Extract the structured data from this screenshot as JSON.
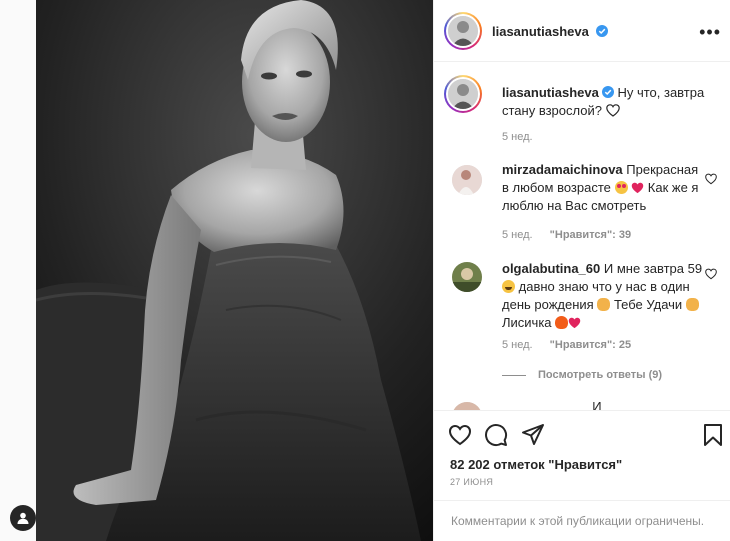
{
  "post": {
    "username": "liasanutiasheva",
    "caption": "Ну что, завтра стану взрослой?",
    "caption_time": "5 нед."
  },
  "comments": [
    {
      "username": "mirzadamaichinova",
      "text_parts": [
        "Прекрасная в любом возрасте",
        "Как же я люблю на Вас смотреть"
      ],
      "time": "5 нед.",
      "likes_label": "\"Нравится\": 39"
    },
    {
      "username": "olgalabutina_60",
      "text_parts": [
        "И мне завтра 59",
        "давно знаю что у нас в один день рождения",
        "Тебе Удачи",
        "Лисичка"
      ],
      "time": "5 нед.",
      "likes_label": "\"Нравится\": 25"
    }
  ],
  "view_replies": "Посмотреть ответы (9)",
  "partial_comment_text": "                         И",
  "likes_count": "82 202 отметок \"Нравится\"",
  "post_date": "27 июня",
  "comments_limited": "Комментарии к этой публикации ограничены.",
  "icons": {
    "more": "more-dots-icon",
    "verified": "verified-badge-icon",
    "like": "heart-outline-icon",
    "comment": "comment-bubble-icon",
    "share": "paper-plane-icon",
    "save": "bookmark-icon",
    "profile": "profile-person-icon"
  },
  "colors": {
    "verified": "#3897f0",
    "emoji_red_heart": "#e0245e",
    "muted_text": "#8e8e8e"
  }
}
